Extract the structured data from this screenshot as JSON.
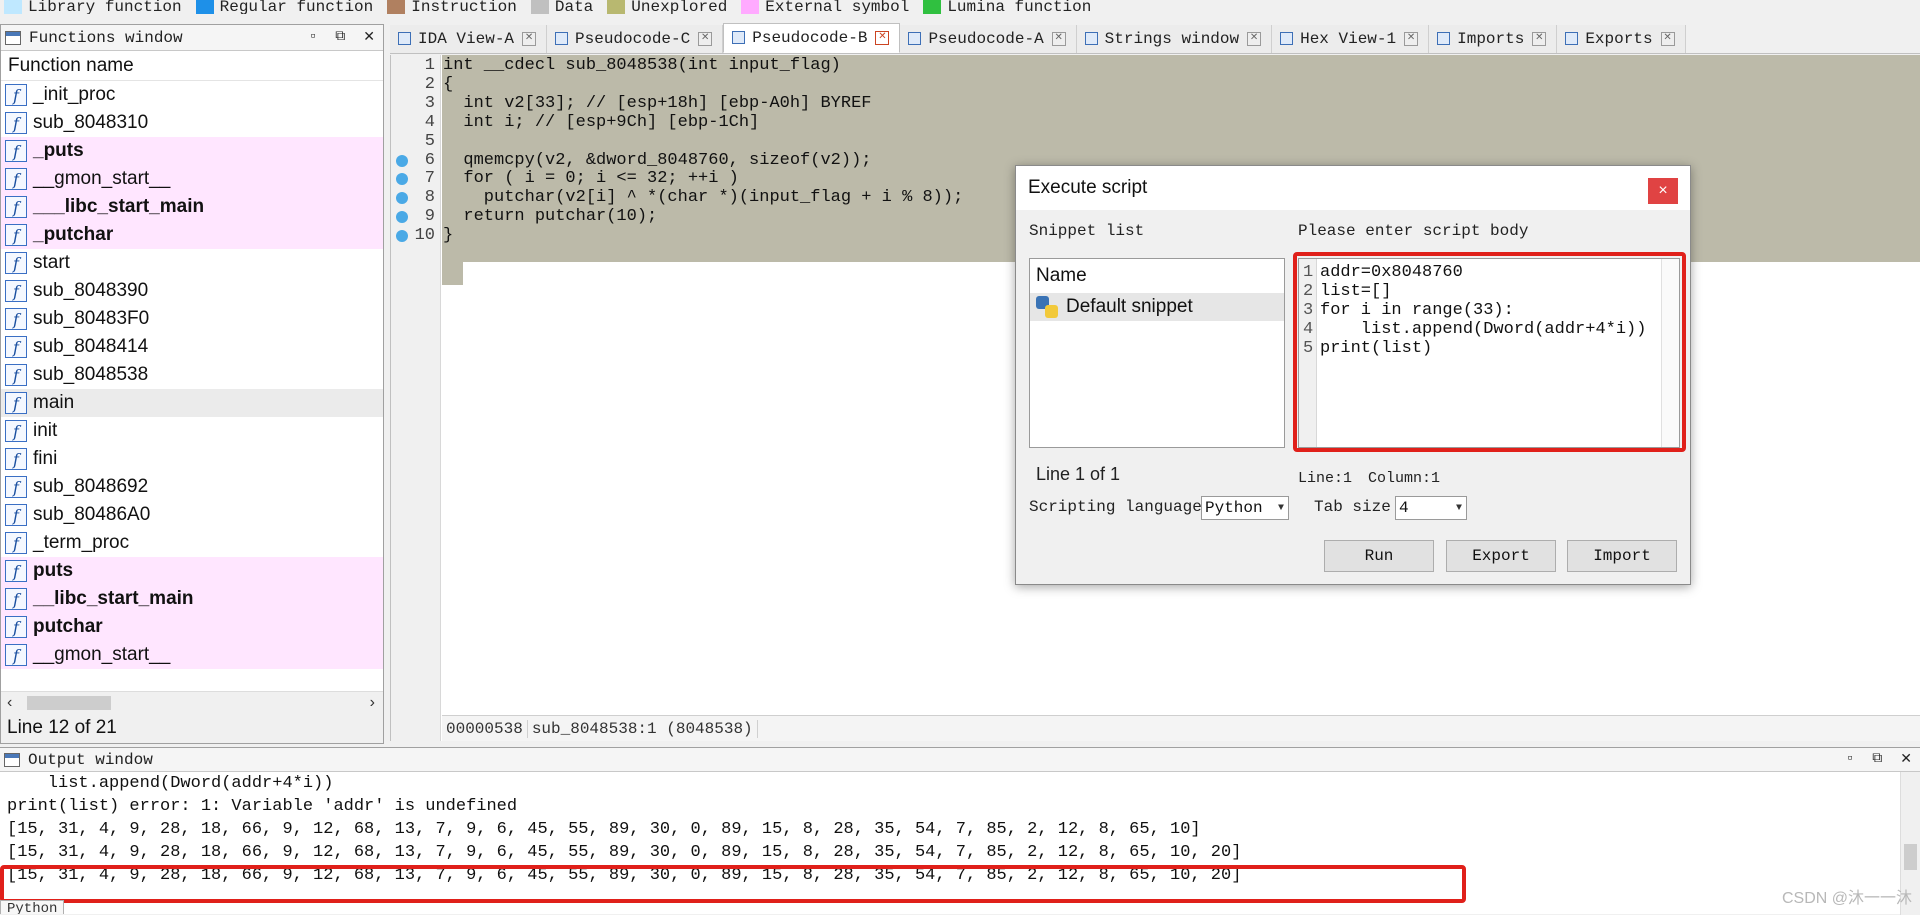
{
  "legend": [
    {
      "label": "Library function",
      "color": "#bfe8ff"
    },
    {
      "label": "Regular function",
      "color": "#1e90e8"
    },
    {
      "label": "Instruction",
      "color": "#b08060"
    },
    {
      "label": "Data",
      "color": "#c0c0c0"
    },
    {
      "label": "Unexplored",
      "color": "#b8b870"
    },
    {
      "label": "External symbol",
      "color": "#ffaaff"
    },
    {
      "label": "Lumina function",
      "color": "#30c040"
    }
  ],
  "functions_window": {
    "title": "Functions window",
    "column_header": "Function name",
    "items": [
      {
        "name": "_init_proc",
        "style": "normal"
      },
      {
        "name": "sub_8048310",
        "style": "normal"
      },
      {
        "name": "_puts",
        "style": "ext"
      },
      {
        "name": "__gmon_start__",
        "style": "ext-normal"
      },
      {
        "name": "___libc_start_main",
        "style": "ext"
      },
      {
        "name": "_putchar",
        "style": "ext"
      },
      {
        "name": "start",
        "style": "normal"
      },
      {
        "name": "sub_8048390",
        "style": "normal"
      },
      {
        "name": "sub_80483F0",
        "style": "normal"
      },
      {
        "name": "sub_8048414",
        "style": "normal"
      },
      {
        "name": "sub_8048538",
        "style": "normal"
      },
      {
        "name": "main",
        "style": "selected"
      },
      {
        "name": "init",
        "style": "normal"
      },
      {
        "name": "fini",
        "style": "normal"
      },
      {
        "name": "sub_8048692",
        "style": "normal"
      },
      {
        "name": "sub_80486A0",
        "style": "normal"
      },
      {
        "name": "_term_proc",
        "style": "normal"
      },
      {
        "name": "puts",
        "style": "ext"
      },
      {
        "name": "__libc_start_main",
        "style": "ext"
      },
      {
        "name": "putchar",
        "style": "ext"
      },
      {
        "name": "__gmon_start__",
        "style": "ext-normal"
      }
    ],
    "status": "Line 12 of 21"
  },
  "tabs": [
    {
      "label": "IDA View-A",
      "active": false
    },
    {
      "label": "Pseudocode-C",
      "active": false
    },
    {
      "label": "Pseudocode-B",
      "active": true
    },
    {
      "label": "Pseudocode-A",
      "active": false
    },
    {
      "label": "Strings window",
      "active": false
    },
    {
      "label": "Hex View-1",
      "active": false
    },
    {
      "label": "Imports",
      "active": false
    },
    {
      "label": "Exports",
      "active": false
    }
  ],
  "pseudocode": {
    "lines": [
      {
        "num": "1",
        "text": "int __cdecl sub_8048538(int input_flag)",
        "bp": false
      },
      {
        "num": "2",
        "text": "{",
        "bp": false
      },
      {
        "num": "3",
        "text": "  int v2[33]; // [esp+18h] [ebp-A0h] BYREF",
        "bp": false
      },
      {
        "num": "4",
        "text": "  int i; // [esp+9Ch] [ebp-1Ch]",
        "bp": false
      },
      {
        "num": "5",
        "text": "",
        "bp": false
      },
      {
        "num": "6",
        "text": "  qmemcpy(v2, &dword_8048760, sizeof(v2));",
        "bp": true
      },
      {
        "num": "7",
        "text": "  for ( i = 0; i <= 32; ++i )",
        "bp": true
      },
      {
        "num": "8",
        "text": "    putchar(v2[i] ^ *(char *)(input_flag + i % 8));",
        "bp": true
      },
      {
        "num": "9",
        "text": "  return putchar(10);",
        "bp": true
      },
      {
        "num": "10",
        "text": "}",
        "bp": true
      }
    ],
    "status_address": "00000538",
    "status_location": "sub_8048538:1 (8048538)"
  },
  "dialog": {
    "title": "Execute script",
    "close_label": "×",
    "snippet_list_label": "Snippet list",
    "script_body_label": "Please enter script body",
    "list_header": "Name",
    "snippets": [
      "Default snippet"
    ],
    "script_lines": [
      {
        "num": "1",
        "text": "addr=0x8048760"
      },
      {
        "num": "2",
        "text": "list=[]"
      },
      {
        "num": "3",
        "text": "for i in range(33):"
      },
      {
        "num": "4",
        "text": "    list.append(Dword(addr+4*i))"
      },
      {
        "num": "5",
        "text": "print(list)"
      }
    ],
    "snippet_status": "Line 1 of 1",
    "cursor_line": "Line:1",
    "cursor_col": "Column:1",
    "scripting_language_label": "Scripting language",
    "scripting_language_value": "Python",
    "tab_size_label": "Tab size",
    "tab_size_value": "4",
    "buttons": {
      "run": "Run",
      "export": "Export",
      "import": "Import"
    }
  },
  "output_window": {
    "title": "Output window",
    "lines": [
      "    list.append(Dword(addr+4*i))",
      "print(list) error: 1: Variable 'addr' is undefined",
      "[15, 31, 4, 9, 28, 18, 66, 9, 12, 68, 13, 7, 9, 6, 45, 55, 89, 30, 0, 89, 15, 8, 28, 35, 54, 7, 85, 2, 12, 8, 65, 10]",
      "[15, 31, 4, 9, 28, 18, 66, 9, 12, 68, 13, 7, 9, 6, 45, 55, 89, 30, 0, 89, 15, 8, 28, 35, 54, 7, 85, 2, 12, 8, 65, 10, 20]",
      "[15, 31, 4, 9, 28, 18, 66, 9, 12, 68, 13, 7, 9, 6, 45, 55, 89, 30, 0, 89, 15, 8, 28, 35, 54, 7, 85, 2, 12, 8, 65, 10, 20]"
    ],
    "input_tab": "Python"
  },
  "watermark": "CSDN @沐一一沐"
}
